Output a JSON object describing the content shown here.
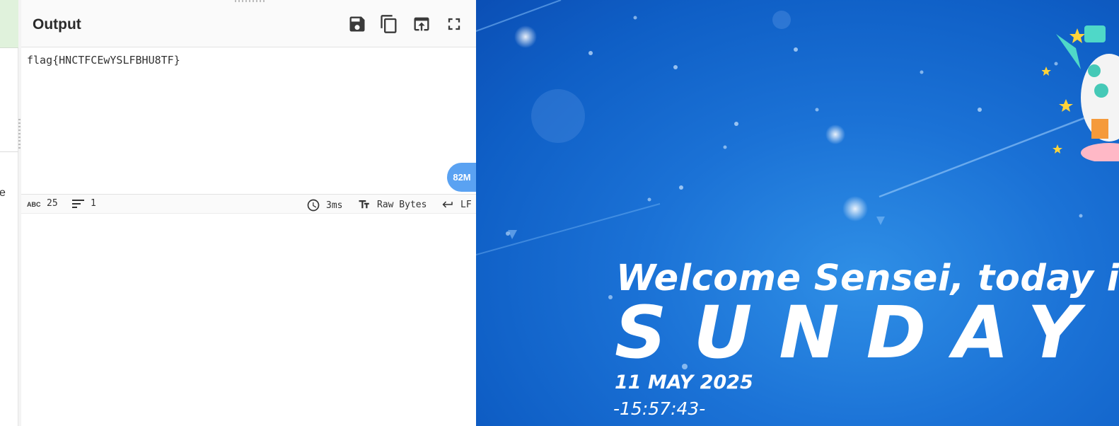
{
  "left_pane": {
    "peek_text": "e"
  },
  "output": {
    "title": "Output",
    "toolbar": [
      {
        "name": "save-button",
        "icon": "save-icon"
      },
      {
        "name": "copy-button",
        "icon": "copy-icon"
      },
      {
        "name": "replace-input-button",
        "icon": "open-in-input-icon"
      },
      {
        "name": "maximize-button",
        "icon": "fullscreen-icon"
      }
    ],
    "text": "flag{HNCTFCEwYSLFBHU8TF}",
    "memory_badge": "82M"
  },
  "status_bar": {
    "chars_icon": "abc-icon",
    "chars": "25",
    "lines_icon": "lines-icon",
    "lines": "1",
    "time_icon": "clock-icon",
    "time": "3ms",
    "encoding_icon": "text-size-icon",
    "encoding": "Raw Bytes",
    "eol_icon": "return-icon",
    "eol": "LF"
  },
  "wallpaper": {
    "welcome": "Welcome Sensei, today is:",
    "day": "SUNDAY",
    "date": "11 MAY 2025",
    "time": "-15:57:43-",
    "colors": {
      "sky": "#1b72d6",
      "text": "#ffffff"
    }
  },
  "colors": {
    "accent_badge": "#5aa2f2",
    "header_bg": "#fafafa",
    "left_strip_green": "#e0f2dc"
  }
}
